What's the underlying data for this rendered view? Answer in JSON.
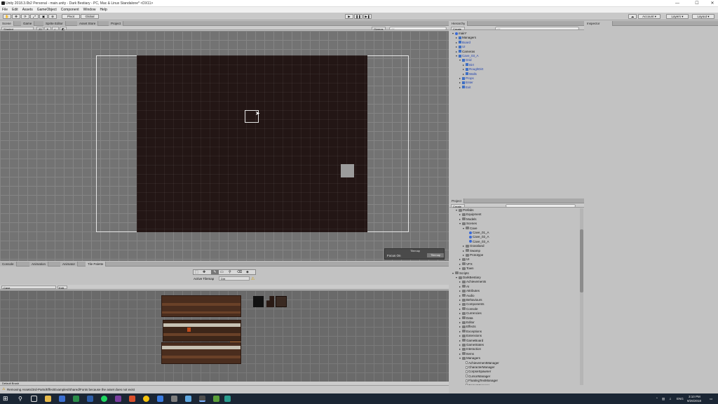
{
  "window": {
    "title": "Unity 2018.3.0b2 Personal - main.unity - Dark Bestiary - PC, Mac & Linux Standalone* <DX11>",
    "minimize": "—",
    "maximize": "☐",
    "close": "✕"
  },
  "menu": [
    "File",
    "Edit",
    "Assets",
    "GameObject",
    "Component",
    "Window",
    "Help"
  ],
  "toolbar": {
    "pivot": "Pivot",
    "global": "Global",
    "play": "▶",
    "pause": "❚❚",
    "step": "▶❚",
    "account": "Account",
    "layers": "Layers",
    "layout": "Layout"
  },
  "scene": {
    "tabs": [
      "Scene",
      "Game",
      "Sprite Editor",
      "Asset Store",
      "Project"
    ],
    "shading": "Shaded",
    "mode_2d": "2D",
    "gizmos": "Gizmos",
    "search_placeholder": "All"
  },
  "tilemap_overlay": {
    "title": "Tilemap",
    "focus_label": "Focus On",
    "focus_value": "Tilemap"
  },
  "bottom": {
    "tabs": [
      "Console",
      "Animation",
      "Animator",
      "Tile Palette"
    ],
    "active_tilemap_label": "Active Tilemap",
    "active_tilemap_value": "Dirt",
    "palette_name": "Cave",
    "edit_button": "Edit",
    "brush": "Default Brush"
  },
  "hierarchy": {
    "tab": "Hierarchy",
    "create": "Create",
    "search_placeholder": "All",
    "items": [
      {
        "label": "main*",
        "depth": 0
      },
      {
        "label": "Managers",
        "depth": 1
      },
      {
        "label": "Board",
        "depth": 1
      },
      {
        "label": "UI",
        "depth": 1
      },
      {
        "label": "Cameras",
        "depth": 1
      },
      {
        "label": "Cave_03_A",
        "depth": 1
      },
      {
        "label": "Grid",
        "depth": 2
      },
      {
        "label": "Dirt",
        "depth": 3
      },
      {
        "label": "RoughDirt",
        "depth": 3
      },
      {
        "label": "Walls",
        "depth": 3
      },
      {
        "label": "Props",
        "depth": 2
      },
      {
        "label": "Enter",
        "depth": 2
      },
      {
        "label": "Exit",
        "depth": 2
      }
    ]
  },
  "inspector": {
    "tab": "Inspector"
  },
  "project": {
    "tab": "Project",
    "create": "Create",
    "items": [
      {
        "label": "Prefabs",
        "depth": 1
      },
      {
        "label": "Equipment",
        "depth": 2
      },
      {
        "label": "Models",
        "depth": 2
      },
      {
        "label": "Scenes",
        "depth": 2
      },
      {
        "label": "Cave",
        "depth": 3
      },
      {
        "label": "Cave_01_A",
        "depth": 4
      },
      {
        "label": "Cave_02_A",
        "depth": 4
      },
      {
        "label": "Cave_03_A",
        "depth": 4
      },
      {
        "label": "Grassland",
        "depth": 3
      },
      {
        "label": "Swamp",
        "depth": 3
      },
      {
        "label": "Prototype",
        "depth": 3
      },
      {
        "label": "UI",
        "depth": 2
      },
      {
        "label": "VFX",
        "depth": 2
      },
      {
        "label": "Town",
        "depth": 2
      },
      {
        "label": "Scripts",
        "depth": 0
      },
      {
        "label": "DarkBestiary",
        "depth": 1
      },
      {
        "label": "Achievements",
        "depth": 2
      },
      {
        "label": "AI",
        "depth": 2
      },
      {
        "label": "Attributes",
        "depth": 2
      },
      {
        "label": "Audio",
        "depth": 2
      },
      {
        "label": "Behaviours",
        "depth": 2
      },
      {
        "label": "Components",
        "depth": 2
      },
      {
        "label": "Console",
        "depth": 2
      },
      {
        "label": "Currencies",
        "depth": 2
      },
      {
        "label": "Data",
        "depth": 2
      },
      {
        "label": "Editor",
        "depth": 2
      },
      {
        "label": "Effects",
        "depth": 2
      },
      {
        "label": "Exceptions",
        "depth": 2
      },
      {
        "label": "Extensions",
        "depth": 2
      },
      {
        "label": "GameBoard",
        "depth": 2
      },
      {
        "label": "GameStates",
        "depth": 2
      },
      {
        "label": "Interaction",
        "depth": 2
      },
      {
        "label": "Items",
        "depth": 2
      },
      {
        "label": "Managers",
        "depth": 2
      },
      {
        "label": "AchievementManager",
        "depth": 3
      },
      {
        "label": "CharacterManager",
        "depth": 3
      },
      {
        "label": "CorpseSpawner",
        "depth": 3
      },
      {
        "label": "CursorManager",
        "depth": 3
      },
      {
        "label": "FloatingTextManager",
        "depth": 3
      },
      {
        "label": "GameManager",
        "depth": 3
      }
    ]
  },
  "status": {
    "message": "Removing Assets/3rd-Parts/EffectExamples/Shared/Fonts because the asset does not exist"
  },
  "taskbar": {
    "language": "ENG",
    "time": "3:10 PM",
    "date": "9/26/2018"
  }
}
